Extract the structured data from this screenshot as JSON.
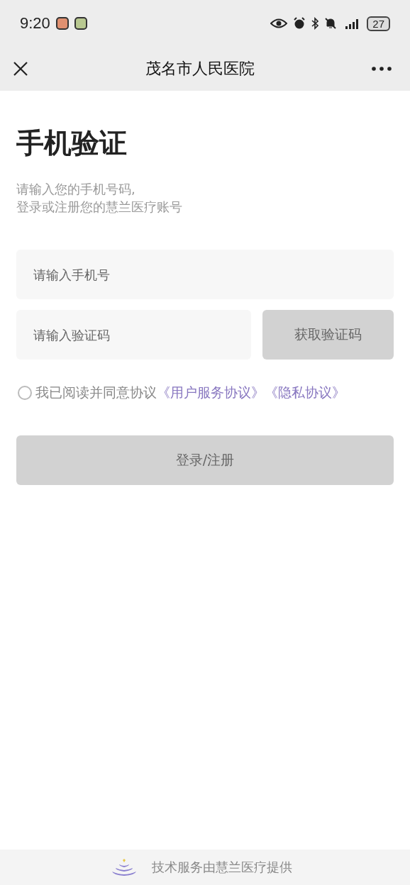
{
  "status_bar": {
    "time": "9:20",
    "battery": "27"
  },
  "nav": {
    "title": "茂名市人民医院"
  },
  "heading": "手机验证",
  "subtitle_lines": [
    "请输入您的手机号码,",
    "登录或注册您的慧兰医疗账号"
  ],
  "phone_field": {
    "placeholder": "请输入手机号"
  },
  "code_field": {
    "placeholder": "请输入验证码"
  },
  "get_code_button": {
    "label": "获取验证码",
    "disabled": true
  },
  "agreement": {
    "checked": false,
    "text": "我已阅读并同意协议",
    "links": [
      "《用户服务协议》",
      "《隐私协议》"
    ]
  },
  "login_button": {
    "label": "登录/注册",
    "disabled": true
  },
  "footer": {
    "text": "技术服务由慧兰医疗提供"
  }
}
